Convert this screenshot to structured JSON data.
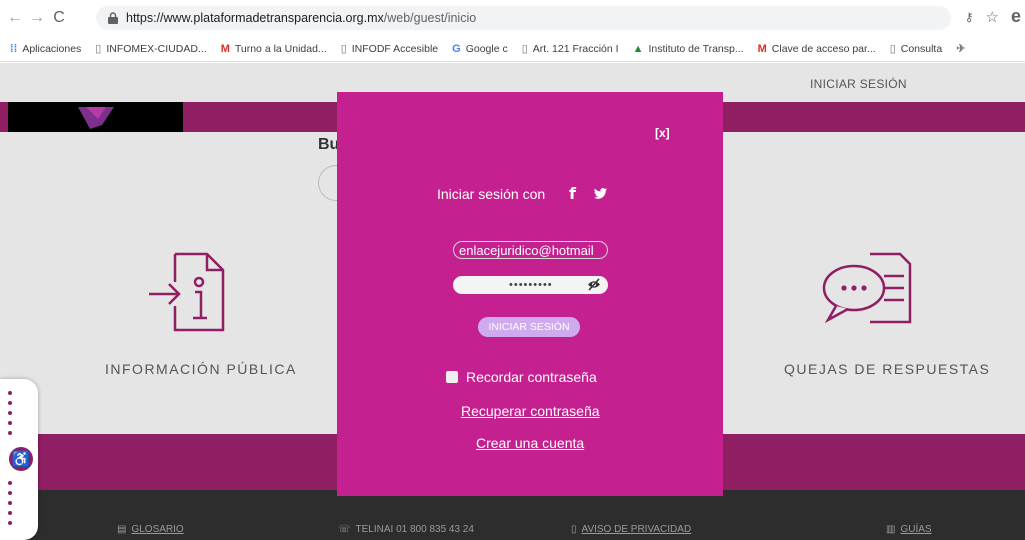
{
  "browser": {
    "url_main": "https://www.plataformadetransparencia.org.mx",
    "url_path": "/web/guest/inicio",
    "bookmarks": [
      {
        "label": "Aplicaciones",
        "icon": "apps-grid-icon"
      },
      {
        "label": "INFOMEX-CIUDAD...",
        "icon": "page-icon"
      },
      {
        "label": "Turno a la Unidad...",
        "icon": "gmail-icon"
      },
      {
        "label": "INFODF Accesible",
        "icon": "page-icon"
      },
      {
        "label": "Google c",
        "icon": "google-icon"
      },
      {
        "label": "Art. 121 Fracción I",
        "icon": "page-icon"
      },
      {
        "label": "Instituto de Transp...",
        "icon": "institute-icon"
      },
      {
        "label": "Clave de acceso par...",
        "icon": "gmail-icon"
      },
      {
        "label": "Consulta",
        "icon": "page-icon"
      }
    ]
  },
  "page": {
    "login_link": "INICIAR SESIÓN",
    "search_heading": "Bu",
    "cards": [
      {
        "title": "INFORMACIÓN PÚBLICA",
        "icon": "document-info-icon"
      },
      {
        "title": "QUEJAS DE RESPUESTAS",
        "icon": "chat-document-icon"
      }
    ],
    "footer": [
      {
        "label": "GLOSARIO",
        "icon": "glossary-icon"
      },
      {
        "label": "TELINAI 01 800 835 43 24",
        "icon": "phone-icon"
      },
      {
        "label": "AVISO DE PRIVACIDAD",
        "icon": "privacy-icon"
      },
      {
        "label": "GUÍAS",
        "icon": "guides-icon"
      }
    ]
  },
  "modal": {
    "close_label": "[x]",
    "login_with": "Iniciar sesión con",
    "email_value": "enlacejuridico@hotmail",
    "password_value": "•••••••••",
    "login_button": "INICIAR SESIÓN",
    "remember_label": "Recordar contraseña",
    "recover_link": "Recuperar contraseña",
    "create_link": "Crear una cuenta"
  },
  "colors": {
    "accent": "#c5208f",
    "band": "#8f1e63",
    "button": "#ceabef"
  }
}
